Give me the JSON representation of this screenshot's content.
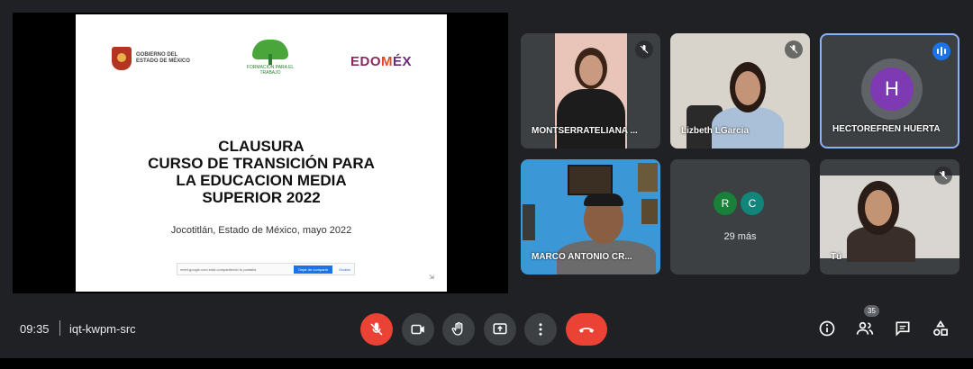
{
  "slide": {
    "gov_logo_text": "GOBIERNO DEL ESTADO DE MÉXICO",
    "center_logo_text": "FORMACIÓN PARA EL TRABAJO",
    "right_logo": [
      "EDO",
      "M",
      "ÉX"
    ],
    "title_lines": [
      "CLAUSURA",
      "CURSO DE TRANSICIÓN PARA",
      "LA EDUCACION MEDIA",
      "SUPERIOR 2022"
    ],
    "subtitle": "Jocotitlán, Estado de México, mayo 2022",
    "share_notice": "meet.google.com está compartiendo tu pantalla",
    "share_stop": "Dejar de compartir",
    "share_hide": "Ocultar"
  },
  "participants": [
    {
      "name": "MONTSERRATELIANA ...",
      "muted": true
    },
    {
      "name": "Lizbeth LGarcia",
      "muted": true
    },
    {
      "name": "HECTOREFREN HUERTA",
      "initial": "H",
      "speaking": true
    },
    {
      "name": "MARCO ANTONIO CR...",
      "muted": false
    },
    {
      "initials": [
        "R",
        "C"
      ],
      "more": "29 más"
    },
    {
      "name": "Tú",
      "muted": true
    }
  ],
  "meeting": {
    "time": "09:35",
    "code": "iqt-kwpm-src",
    "people_count": "35"
  },
  "colors": {
    "background": "#202124",
    "tile": "#3c4043",
    "red": "#ea4335",
    "accent": "#8ab4f8",
    "avatar_purple": "#7e3ab2",
    "avatar_r": "#188038",
    "avatar_c": "#12857a"
  },
  "icons": {
    "mic": "mic-off-icon",
    "camera": "camera-icon",
    "hand": "raise-hand-icon",
    "present": "present-icon",
    "more": "more-vert-icon",
    "hangup": "hangup-icon",
    "info": "info-icon",
    "people": "people-icon",
    "chat": "chat-icon",
    "activities": "activities-icon"
  }
}
